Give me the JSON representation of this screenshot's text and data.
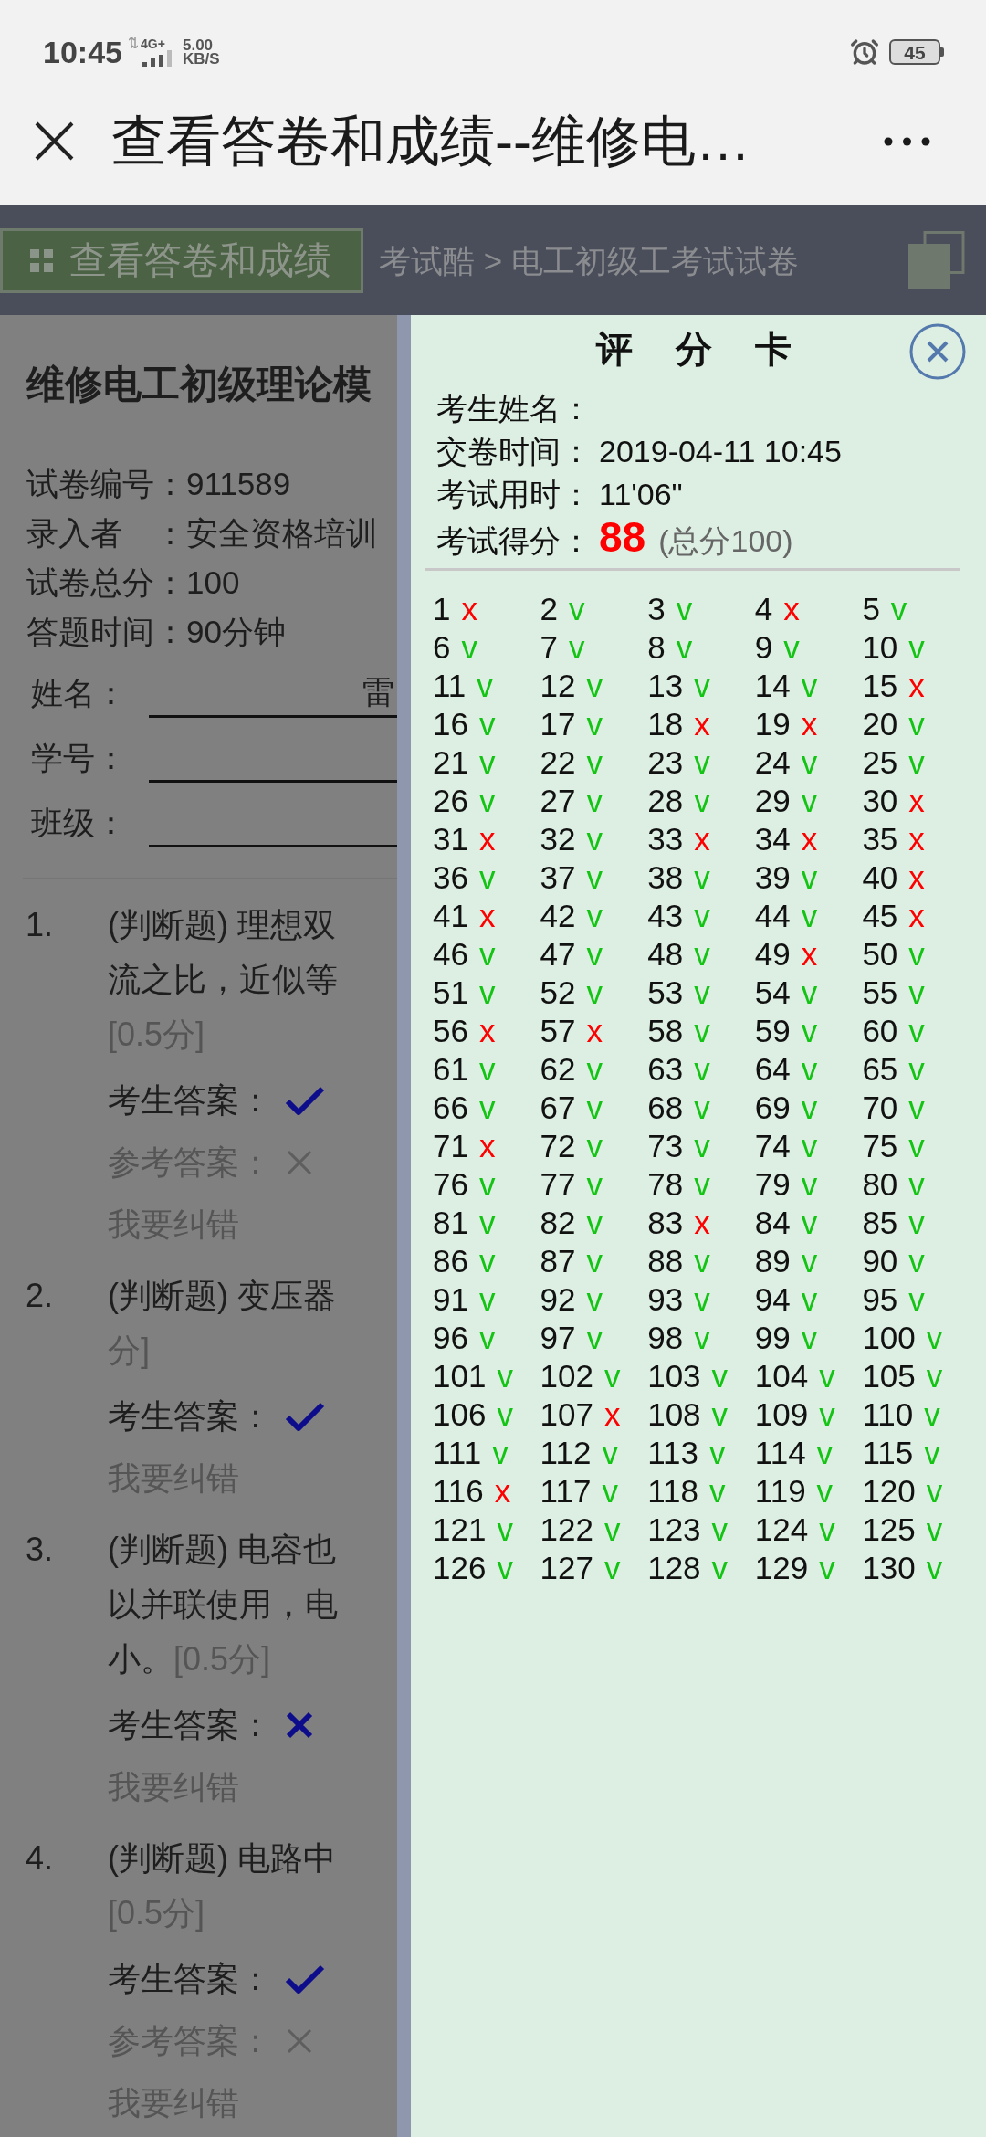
{
  "status_bar": {
    "time": "10:45",
    "network": "4G+",
    "speed": "5.00",
    "speed_unit": "KB/S",
    "battery": "45"
  },
  "header": {
    "title": "查看答卷和成绩--维修电…"
  },
  "toolbar": {
    "button": "查看答卷和成绩",
    "breadcrumb": "考试酷 > 电工初级工考试试卷"
  },
  "paper": {
    "title": "维修电工初级理论模",
    "info": [
      {
        "label": "试卷编号：",
        "value": "911589"
      },
      {
        "label": "录入者　：",
        "value": "安全资格培训"
      },
      {
        "label": "试卷总分：",
        "value": "100"
      },
      {
        "label": "答题时间：",
        "value": "90分钟"
      }
    ],
    "fields": [
      {
        "label": "姓名：",
        "value": "雷"
      },
      {
        "label": "学号："
      },
      {
        "label": "班级："
      }
    ],
    "questions": [
      {
        "number": "1.",
        "lines": [
          [
            {
              "kind": "text",
              "text": "(判断题) 理想双"
            }
          ],
          [
            {
              "kind": "text",
              "text": "流之比，近似等"
            }
          ],
          [
            {
              "kind": "points",
              "text": "[0.5分]"
            }
          ]
        ],
        "student_answer": {
          "label": "考生答案：",
          "kind": "check"
        },
        "reference_answer": {
          "label": "参考答案：",
          "kind": "cross"
        },
        "report": "我要纠错"
      },
      {
        "number": "2.",
        "lines": [
          [
            {
              "kind": "text",
              "text": "(判断题) 变压器"
            }
          ],
          [
            {
              "kind": "points",
              "text": "分]"
            }
          ]
        ],
        "student_answer": {
          "label": "考生答案：",
          "kind": "check"
        },
        "report": "我要纠错"
      },
      {
        "number": "3.",
        "lines": [
          [
            {
              "kind": "text",
              "text": "(判断题) 电容也"
            }
          ],
          [
            {
              "kind": "text",
              "text": "以并联使用，电"
            }
          ],
          [
            {
              "kind": "text",
              "text": "小。"
            },
            {
              "kind": "points",
              "text": "[0.5分]"
            }
          ]
        ],
        "student_answer": {
          "label": "考生答案：",
          "kind": "cross"
        },
        "report": "我要纠错"
      },
      {
        "number": "4.",
        "lines": [
          [
            {
              "kind": "text",
              "text": "(判断题) 电路中"
            }
          ],
          [
            {
              "kind": "points",
              "text": "[0.5分]"
            }
          ]
        ],
        "student_answer": {
          "label": "考生答案：",
          "kind": "check"
        },
        "reference_answer": {
          "label": "参考答案：",
          "kind": "cross"
        },
        "report": "我要纠错"
      }
    ]
  },
  "score_card": {
    "title": "评 分 卡",
    "rows": [
      {
        "label": "考生姓名："
      },
      {
        "label": "交卷时间：",
        "value": "2019-04-11 10:45"
      },
      {
        "label": "考试用时：",
        "value": "11'06\""
      },
      {
        "label": "考试得分：",
        "score": "88",
        "total": "(总分100)"
      }
    ],
    "results": [
      {
        "number": "1",
        "mark": "x",
        "correct": false
      },
      {
        "number": "2",
        "mark": "v",
        "correct": true
      },
      {
        "number": "3",
        "mark": "v",
        "correct": true
      },
      {
        "number": "4",
        "mark": "x",
        "correct": false
      },
      {
        "number": "5",
        "mark": "v",
        "correct": true
      },
      {
        "number": "6",
        "mark": "v",
        "correct": true
      },
      {
        "number": "7",
        "mark": "v",
        "correct": true
      },
      {
        "number": "8",
        "mark": "v",
        "correct": true
      },
      {
        "number": "9",
        "mark": "v",
        "correct": true
      },
      {
        "number": "10",
        "mark": "v",
        "correct": true
      },
      {
        "number": "11",
        "mark": "v",
        "correct": true
      },
      {
        "number": "12",
        "mark": "v",
        "correct": true
      },
      {
        "number": "13",
        "mark": "v",
        "correct": true
      },
      {
        "number": "14",
        "mark": "v",
        "correct": true
      },
      {
        "number": "15",
        "mark": "x",
        "correct": false
      },
      {
        "number": "16",
        "mark": "v",
        "correct": true
      },
      {
        "number": "17",
        "mark": "v",
        "correct": true
      },
      {
        "number": "18",
        "mark": "x",
        "correct": false
      },
      {
        "number": "19",
        "mark": "x",
        "correct": false
      },
      {
        "number": "20",
        "mark": "v",
        "correct": true
      },
      {
        "number": "21",
        "mark": "v",
        "correct": true
      },
      {
        "number": "22",
        "mark": "v",
        "correct": true
      },
      {
        "number": "23",
        "mark": "v",
        "correct": true
      },
      {
        "number": "24",
        "mark": "v",
        "correct": true
      },
      {
        "number": "25",
        "mark": "v",
        "correct": true
      },
      {
        "number": "26",
        "mark": "v",
        "correct": true
      },
      {
        "number": "27",
        "mark": "v",
        "correct": true
      },
      {
        "number": "28",
        "mark": "v",
        "correct": true
      },
      {
        "number": "29",
        "mark": "v",
        "correct": true
      },
      {
        "number": "30",
        "mark": "x",
        "correct": false
      },
      {
        "number": "31",
        "mark": "x",
        "correct": false
      },
      {
        "number": "32",
        "mark": "v",
        "correct": true
      },
      {
        "number": "33",
        "mark": "x",
        "correct": false
      },
      {
        "number": "34",
        "mark": "x",
        "correct": false
      },
      {
        "number": "35",
        "mark": "x",
        "correct": false
      },
      {
        "number": "36",
        "mark": "v",
        "correct": true
      },
      {
        "number": "37",
        "mark": "v",
        "correct": true
      },
      {
        "number": "38",
        "mark": "v",
        "correct": true
      },
      {
        "number": "39",
        "mark": "v",
        "correct": true
      },
      {
        "number": "40",
        "mark": "x",
        "correct": false
      },
      {
        "number": "41",
        "mark": "x",
        "correct": false
      },
      {
        "number": "42",
        "mark": "v",
        "correct": true
      },
      {
        "number": "43",
        "mark": "v",
        "correct": true
      },
      {
        "number": "44",
        "mark": "v",
        "correct": true
      },
      {
        "number": "45",
        "mark": "x",
        "correct": false
      },
      {
        "number": "46",
        "mark": "v",
        "correct": true
      },
      {
        "number": "47",
        "mark": "v",
        "correct": true
      },
      {
        "number": "48",
        "mark": "v",
        "correct": true
      },
      {
        "number": "49",
        "mark": "x",
        "correct": false
      },
      {
        "number": "50",
        "mark": "v",
        "correct": true
      },
      {
        "number": "51",
        "mark": "v",
        "correct": true
      },
      {
        "number": "52",
        "mark": "v",
        "correct": true
      },
      {
        "number": "53",
        "mark": "v",
        "correct": true
      },
      {
        "number": "54",
        "mark": "v",
        "correct": true
      },
      {
        "number": "55",
        "mark": "v",
        "correct": true
      },
      {
        "number": "56",
        "mark": "x",
        "correct": false
      },
      {
        "number": "57",
        "mark": "x",
        "correct": false
      },
      {
        "number": "58",
        "mark": "v",
        "correct": true
      },
      {
        "number": "59",
        "mark": "v",
        "correct": true
      },
      {
        "number": "60",
        "mark": "v",
        "correct": true
      },
      {
        "number": "61",
        "mark": "v",
        "correct": true
      },
      {
        "number": "62",
        "mark": "v",
        "correct": true
      },
      {
        "number": "63",
        "mark": "v",
        "correct": true
      },
      {
        "number": "64",
        "mark": "v",
        "correct": true
      },
      {
        "number": "65",
        "mark": "v",
        "correct": true
      },
      {
        "number": "66",
        "mark": "v",
        "correct": true
      },
      {
        "number": "67",
        "mark": "v",
        "correct": true
      },
      {
        "number": "68",
        "mark": "v",
        "correct": true
      },
      {
        "number": "69",
        "mark": "v",
        "correct": true
      },
      {
        "number": "70",
        "mark": "v",
        "correct": true
      },
      {
        "number": "71",
        "mark": "x",
        "correct": false
      },
      {
        "number": "72",
        "mark": "v",
        "correct": true
      },
      {
        "number": "73",
        "mark": "v",
        "correct": true
      },
      {
        "number": "74",
        "mark": "v",
        "correct": true
      },
      {
        "number": "75",
        "mark": "v",
        "correct": true
      },
      {
        "number": "76",
        "mark": "v",
        "correct": true
      },
      {
        "number": "77",
        "mark": "v",
        "correct": true
      },
      {
        "number": "78",
        "mark": "v",
        "correct": true
      },
      {
        "number": "79",
        "mark": "v",
        "correct": true
      },
      {
        "number": "80",
        "mark": "v",
        "correct": true
      },
      {
        "number": "81",
        "mark": "v",
        "correct": true
      },
      {
        "number": "82",
        "mark": "v",
        "correct": true
      },
      {
        "number": "83",
        "mark": "x",
        "correct": false
      },
      {
        "number": "84",
        "mark": "v",
        "correct": true
      },
      {
        "number": "85",
        "mark": "v",
        "correct": true
      },
      {
        "number": "86",
        "mark": "v",
        "correct": true
      },
      {
        "number": "87",
        "mark": "v",
        "correct": true
      },
      {
        "number": "88",
        "mark": "v",
        "correct": true
      },
      {
        "number": "89",
        "mark": "v",
        "correct": true
      },
      {
        "number": "90",
        "mark": "v",
        "correct": true
      },
      {
        "number": "91",
        "mark": "v",
        "correct": true
      },
      {
        "number": "92",
        "mark": "v",
        "correct": true
      },
      {
        "number": "93",
        "mark": "v",
        "correct": true
      },
      {
        "number": "94",
        "mark": "v",
        "correct": true
      },
      {
        "number": "95",
        "mark": "v",
        "correct": true
      },
      {
        "number": "96",
        "mark": "v",
        "correct": true
      },
      {
        "number": "97",
        "mark": "v",
        "correct": true
      },
      {
        "number": "98",
        "mark": "v",
        "correct": true
      },
      {
        "number": "99",
        "mark": "v",
        "correct": true
      },
      {
        "number": "100",
        "mark": "v",
        "correct": true
      },
      {
        "number": "101",
        "mark": "v",
        "correct": true
      },
      {
        "number": "102",
        "mark": "v",
        "correct": true
      },
      {
        "number": "103",
        "mark": "v",
        "correct": true
      },
      {
        "number": "104",
        "mark": "v",
        "correct": true
      },
      {
        "number": "105",
        "mark": "v",
        "correct": true
      },
      {
        "number": "106",
        "mark": "v",
        "correct": true
      },
      {
        "number": "107",
        "mark": "x",
        "correct": false
      },
      {
        "number": "108",
        "mark": "v",
        "correct": true
      },
      {
        "number": "109",
        "mark": "v",
        "correct": true
      },
      {
        "number": "110",
        "mark": "v",
        "correct": true
      },
      {
        "number": "111",
        "mark": "v",
        "correct": true
      },
      {
        "number": "112",
        "mark": "v",
        "correct": true
      },
      {
        "number": "113",
        "mark": "v",
        "correct": true
      },
      {
        "number": "114",
        "mark": "v",
        "correct": true
      },
      {
        "number": "115",
        "mark": "v",
        "correct": true
      },
      {
        "number": "116",
        "mark": "x",
        "correct": false
      },
      {
        "number": "117",
        "mark": "v",
        "correct": true
      },
      {
        "number": "118",
        "mark": "v",
        "correct": true
      },
      {
        "number": "119",
        "mark": "v",
        "correct": true
      },
      {
        "number": "120",
        "mark": "v",
        "correct": true
      },
      {
        "number": "121",
        "mark": "v",
        "correct": true
      },
      {
        "number": "122",
        "mark": "v",
        "correct": true
      },
      {
        "number": "123",
        "mark": "v",
        "correct": true
      },
      {
        "number": "124",
        "mark": "v",
        "correct": true
      },
      {
        "number": "125",
        "mark": "v",
        "correct": true
      },
      {
        "number": "126",
        "mark": "v",
        "correct": true
      },
      {
        "number": "127",
        "mark": "v",
        "correct": true
      },
      {
        "number": "128",
        "mark": "v",
        "correct": true
      },
      {
        "number": "129",
        "mark": "v",
        "correct": true
      },
      {
        "number": "130",
        "mark": "v",
        "correct": true
      }
    ]
  }
}
